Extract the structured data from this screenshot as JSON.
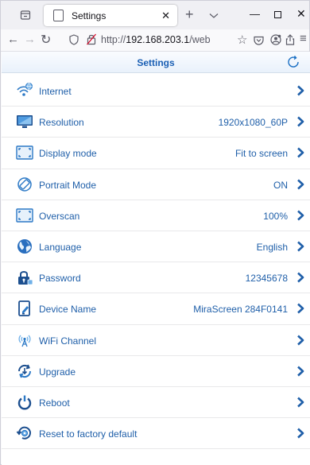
{
  "browser": {
    "tab_title": "Settings",
    "url_prefix": "http://",
    "url_host": "192.168.203.1",
    "url_rest": "/web"
  },
  "page": {
    "title": "Settings"
  },
  "settings": [
    {
      "label": "Internet",
      "value": "",
      "icon": "wifi-globe-icon"
    },
    {
      "label": "Resolution",
      "value": "1920x1080_60P",
      "icon": "monitor-icon"
    },
    {
      "label": "Display mode",
      "value": "Fit to screen",
      "icon": "fit-screen-icon"
    },
    {
      "label": "Portrait Mode",
      "value": "ON",
      "icon": "rotate-icon"
    },
    {
      "label": "Overscan",
      "value": "100%",
      "icon": "overscan-icon"
    },
    {
      "label": "Language",
      "value": "English",
      "icon": "globe-icon"
    },
    {
      "label": "Password",
      "value": "12345678",
      "icon": "lock-icon"
    },
    {
      "label": "Device Name",
      "value": "MiraScreen 284F0141",
      "icon": "device-edit-icon"
    },
    {
      "label": "WiFi Channel",
      "value": "",
      "icon": "antenna-icon"
    },
    {
      "label": "Upgrade",
      "value": "",
      "icon": "upgrade-icon"
    },
    {
      "label": "Reboot",
      "value": "",
      "icon": "power-icon"
    },
    {
      "label": "Reset to factory default",
      "value": "",
      "icon": "factory-reset-icon"
    }
  ],
  "colors": {
    "accent": "#1f5fa9",
    "title": "#1a5fb4"
  }
}
